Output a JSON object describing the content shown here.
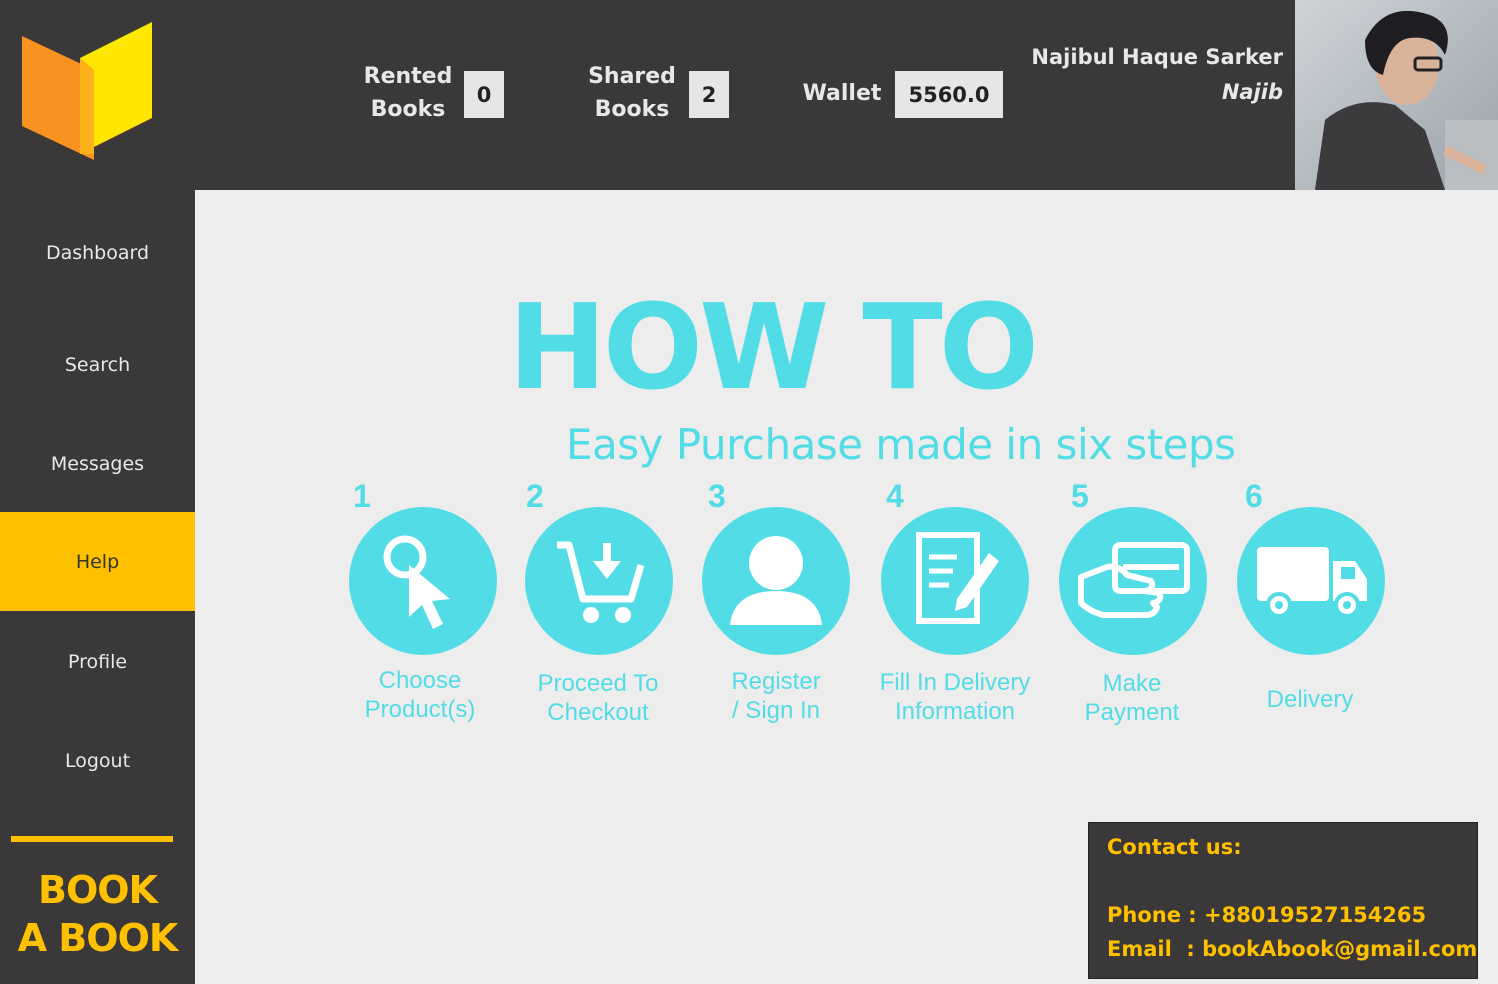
{
  "header": {
    "stats": [
      {
        "label_line1": "Rented",
        "label_line2": "Books",
        "value": "0"
      },
      {
        "label_line1": "Shared",
        "label_line2": "Books",
        "value": "2"
      },
      {
        "label": "Wallet",
        "value": "5560.0"
      }
    ],
    "user": {
      "full_name": "Najibul Haque Sarker",
      "nickname": "Najib"
    }
  },
  "sidebar": {
    "items": [
      {
        "label": "Dashboard",
        "active": false
      },
      {
        "label": "Search",
        "active": false
      },
      {
        "label": "Messages",
        "active": false
      },
      {
        "label": "Help",
        "active": true
      },
      {
        "label": "Profile",
        "active": false
      },
      {
        "label": "Logout",
        "active": false
      }
    ],
    "brand_line1": "BOOK",
    "brand_line2": "A BOOK"
  },
  "help": {
    "title": "HOW TO",
    "subtitle": "Easy Purchase made in six steps",
    "steps": [
      {
        "number": "1",
        "line1": "Choose",
        "line2": "Product(s)",
        "icon": "cursor-click-icon"
      },
      {
        "number": "2",
        "line1": "Proceed To",
        "line2": "Checkout",
        "icon": "cart-download-icon"
      },
      {
        "number": "3",
        "line1": "Register",
        "line2": "/ Sign In",
        "icon": "user-icon"
      },
      {
        "number": "4",
        "line1": "Fill In Delivery",
        "line2": "Information",
        "icon": "form-edit-icon"
      },
      {
        "number": "5",
        "line1": "Make",
        "line2": "Payment",
        "icon": "card-payment-icon"
      },
      {
        "number": "6",
        "line1": "Delivery",
        "line2": "",
        "icon": "truck-icon"
      }
    ]
  },
  "contact": {
    "heading": "Contact us:",
    "phone_label": "Phone :",
    "phone": "+88019527154265",
    "email_label": "Email  :",
    "email": "bookAbook@gmail.com"
  },
  "colors": {
    "dark": "#3a3838",
    "accent": "#ffc000",
    "cyan": "#52dce5",
    "background": "#ededed"
  }
}
